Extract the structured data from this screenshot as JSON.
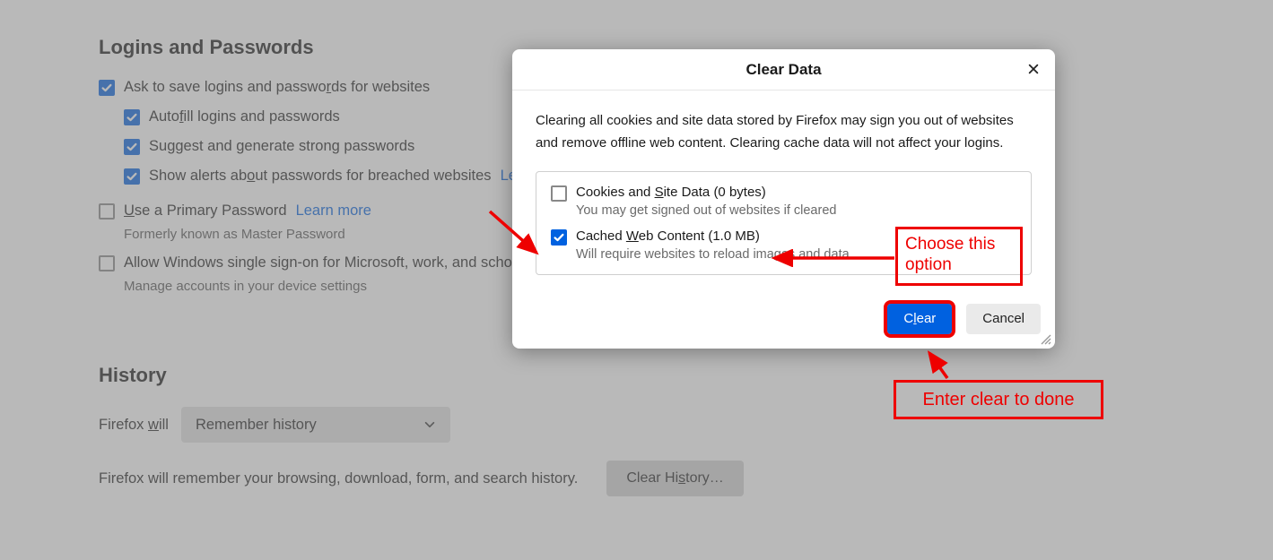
{
  "logins": {
    "heading": "Logins and Passwords",
    "ask_html": "Ask to save logins and passwo<u class='ak'>r</u>ds for websites",
    "autofill_html": "Auto<u class='ak'>f</u>ill logins and passwords",
    "suggest_html": "Su<u class='ak'>g</u>gest and generate strong passwords",
    "alerts_html": "Show alerts ab<u class='ak'>o</u>ut passwords for breached websites",
    "learn_more_trunc": "Lea",
    "primary_html": "<u class='ak'>U</u>se a Primary Password",
    "learn_more": "Learn more",
    "primary_note": "Formerly known as Master Password",
    "sso_html": "Allow Windows single sign-on for Microsoft, work, and scho",
    "sso_note": "Manage accounts in your device settings"
  },
  "history": {
    "heading": "History",
    "will_html": "Firefox <u class='ak'>w</u>ill",
    "selected": "Remember history",
    "desc": "Firefox will remember your browsing, download, form, and search history.",
    "clear_btn_html": "Clear Hi<u class='ak'>s</u>tory…"
  },
  "dialog": {
    "title": "Clear Data",
    "description": "Clearing all cookies and site data stored by Firefox may sign you out of websites and remove offline web content. Clearing cache data will not affect your logins.",
    "cookies_html": "Cookies and <u class='ak'>S</u>ite Data (0 bytes)",
    "cookies_sub": "You may get signed out of websites if cleared",
    "cache_html": "Cached <u class='ak'>W</u>eb Content (1.0 MB)",
    "cache_sub": "Will require websites to reload images and data",
    "clear_html": "C<u class='ak'>l</u>ear",
    "cancel": "Cancel"
  },
  "anno": {
    "choose": "Choose this option",
    "enter": "Enter clear to done"
  }
}
